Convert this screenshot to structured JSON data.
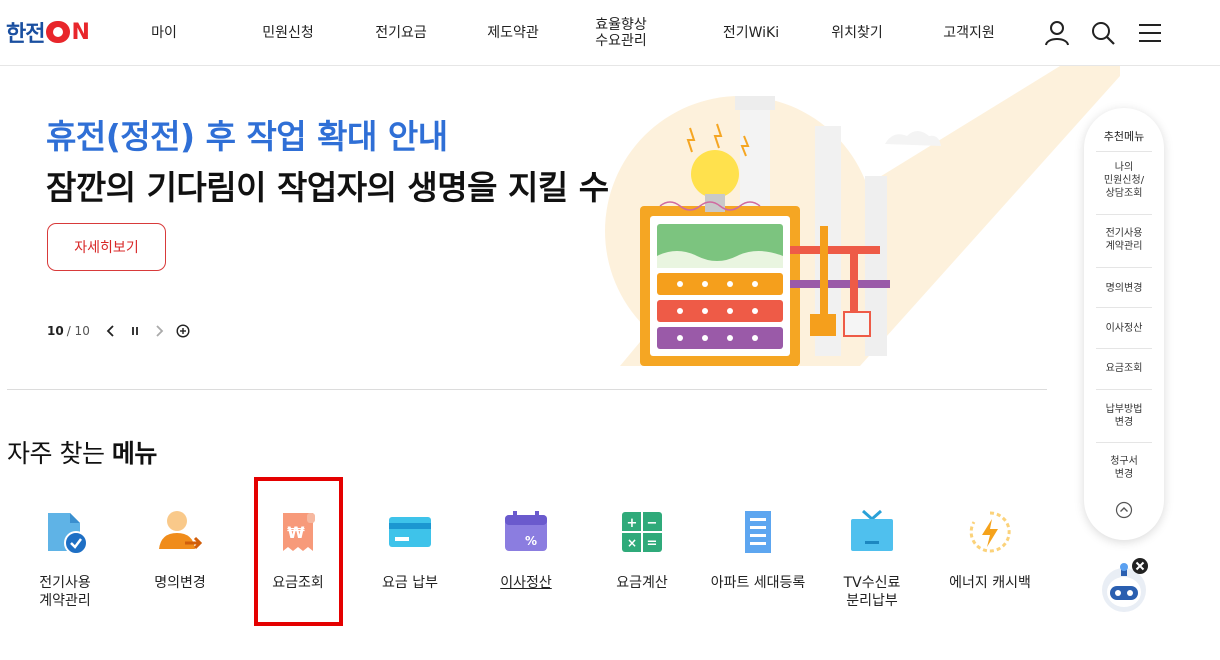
{
  "header": {
    "logo_text": "한전",
    "logo_on": "N",
    "nav": [
      {
        "label": "마이"
      },
      {
        "label": "민원신청"
      },
      {
        "label": "전기요금"
      },
      {
        "label": "제도약관"
      },
      {
        "label": "효율향상\n수요관리"
      },
      {
        "label": "전기WiKi"
      },
      {
        "label": "위치찾기"
      },
      {
        "label": "고객지원"
      }
    ],
    "icons": [
      "user-icon",
      "search-icon",
      "menu-icon"
    ]
  },
  "hero": {
    "title": "휴전(정전) 후 작업 확대 안내",
    "subtitle": "잠깐의 기다림이 작업자의 생명을 지킬 수 있습니다.",
    "detail_button": "자세히보기",
    "slide_current": "10",
    "slide_total": "/ 10"
  },
  "frequent": {
    "title_normal": "자주 찾는 ",
    "title_bold": "메뉴",
    "items": [
      {
        "label": "전기사용\n계약관리",
        "icon": "document-check-icon"
      },
      {
        "label": "명의변경",
        "icon": "person-change-icon"
      },
      {
        "label": "요금조회",
        "icon": "won-receipt-icon"
      },
      {
        "label": "요금 납부",
        "icon": "card-icon"
      },
      {
        "label": "이사정산",
        "icon": "calendar-percent-icon"
      },
      {
        "label": "요금계산",
        "icon": "calculator-icon"
      },
      {
        "label": "아파트 세대등록",
        "icon": "building-icon"
      },
      {
        "label": "TV수신료\n분리납부",
        "icon": "tv-icon"
      },
      {
        "label": "에너지 캐시백",
        "icon": "energy-cashback-icon"
      }
    ]
  },
  "side_panel": {
    "title": "추천메뉴",
    "items": [
      {
        "label": "나의\n민원신청/\n상담조회"
      },
      {
        "label": "전기사용\n계약관리"
      },
      {
        "label": "명의변경"
      },
      {
        "label": "이사정산"
      },
      {
        "label": "요금조회"
      },
      {
        "label": "납부방법\n변경"
      },
      {
        "label": "청구서\n변경"
      }
    ]
  },
  "colors": {
    "brand_blue": "#2f6fd6",
    "brand_red": "#e8262b",
    "highlight": "#e40000"
  }
}
